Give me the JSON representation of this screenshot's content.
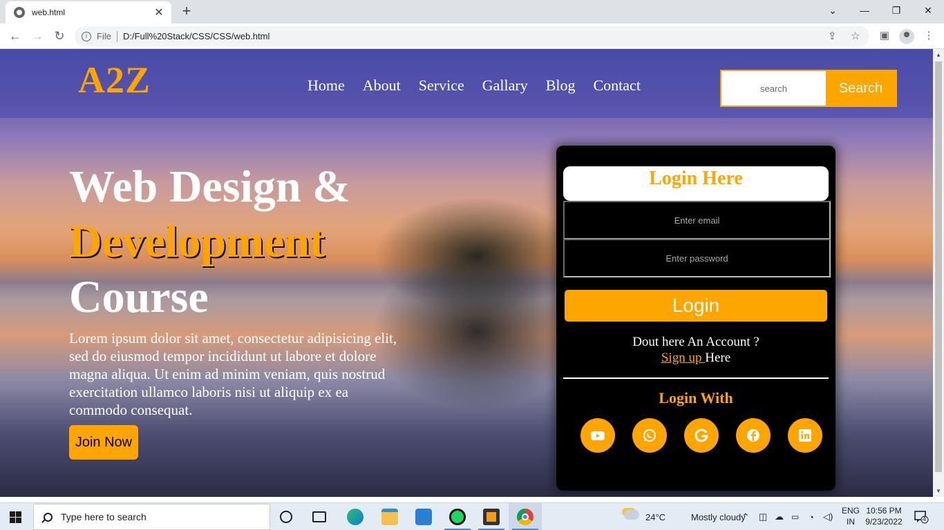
{
  "browser": {
    "tab_title": "web.html",
    "tab_close": "✕",
    "new_tab": "+",
    "address_scheme_label": "File",
    "address_url": "D:/Full%20Stack/CSS/CSS/web.html",
    "window_controls": {
      "dropdown": "⌄",
      "minimize": "—",
      "restore": "❐",
      "close": "✕"
    }
  },
  "page": {
    "logo": "A2Z",
    "nav": [
      "Home",
      "About",
      "Service",
      "Gallary",
      "Blog",
      "Contact"
    ],
    "search": {
      "placeholder": "search",
      "button": "Search"
    },
    "hero": {
      "line1": "Web Design &",
      "line2": "Development",
      "line3": "Course",
      "paragraph": "Lorem ipsum dolor sit amet, consectetur adipisicing elit, sed do eiusmod tempor incididunt ut labore et dolore magna aliqua. Ut enim ad minim veniam, quis nostrud exercitation ullamco laboris nisi ut aliquip ex ea commodo consequat.",
      "cta": "Join Now"
    },
    "login": {
      "title": "Login Here",
      "email_placeholder": "Enter email",
      "password_placeholder": "Enter password",
      "button": "Login",
      "account_question": "Dout here An Account ?",
      "signup_link": "Sign up ",
      "signup_suffix": "Here",
      "login_with": "Login With",
      "social": [
        "youtube",
        "whatsapp",
        "google",
        "facebook",
        "linkedin"
      ]
    }
  },
  "taskbar": {
    "search_placeholder": "Type here to search",
    "weather_temp": "24°C",
    "weather_text": "Mostly cloudy",
    "lang_line1": "ENG",
    "lang_line2": "IN",
    "time": "10:56 PM",
    "date": "9/23/2022",
    "notification_count": "4"
  },
  "colors": {
    "accent": "#ffa500",
    "card": "#000000",
    "nav_overlay": "#4648aa"
  }
}
